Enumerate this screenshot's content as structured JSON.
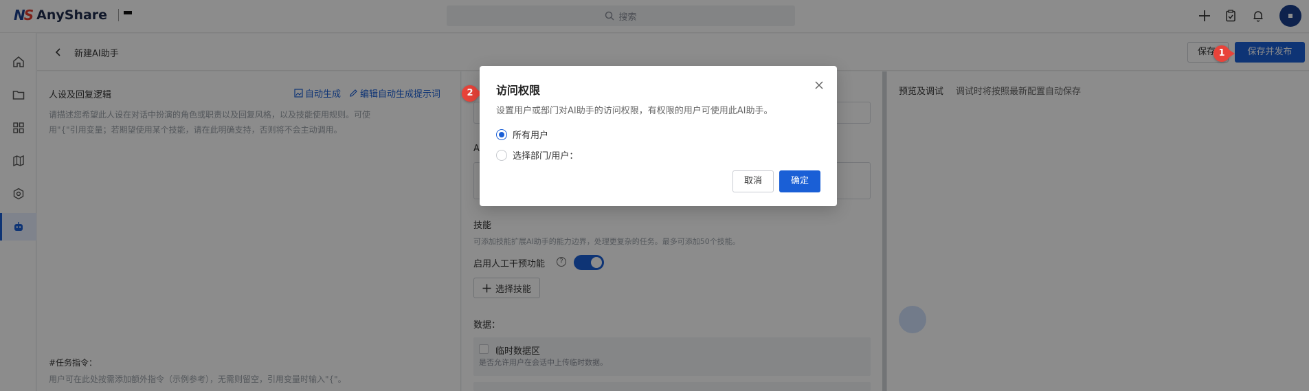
{
  "app": {
    "name": "AnyShare"
  },
  "search": {
    "placeholder": "搜索"
  },
  "header": {
    "title": "新建AI助手",
    "save_label": "保存",
    "publish_label": "保存并发布"
  },
  "left_panel": {
    "persona_title": "人设及回复逻辑",
    "auto_generate": "自动生成",
    "edit_prompt": "编辑自动生成提示词",
    "persona_placeholder_1": "请描述您希望此人设在对话中扮演的角色或职责以及回复风格，以及技能使用规则。可使",
    "persona_placeholder_2": "用\"{\"引用变量；若期望使用某个技能，请在此明确支持，否则将不会主动调用。",
    "task_title": "#任务指令：",
    "task_placeholder": "用户可在此处按需添加额外指令（示例参考），无需则留空，引用变量时输入\"{\"。"
  },
  "mid_panel": {
    "partial_label": "A",
    "skills_title": "技能",
    "skills_desc": "可添加技能扩展AI助手的能力边界，处理更复杂的任务。最多可添加50个技能。",
    "manual_label": "启用人工干预功能",
    "select_skill": "选择技能",
    "data_title": "数据：",
    "temp_data_title": "临时数据区",
    "temp_data_desc": "是否允许用户在会话中上传临时数据。"
  },
  "right_panel": {
    "preview_title": "预览及调试",
    "preview_desc": "调试时将按照最新配置自动保存"
  },
  "modal": {
    "title": "访问权限",
    "description": "设置用户或部门对AI助手的访问权限，有权限的用户可使用此AI助手。",
    "option_all": "所有用户",
    "option_select": "选择部门/用户：",
    "selected": "所有用户",
    "cancel": "取消",
    "confirm": "确定"
  },
  "steps": {
    "one": "1",
    "two": "2"
  },
  "colors": {
    "accent": "#1a5fd6",
    "step_marker": "#e8433a",
    "brand_dark": "#1a3e8c"
  },
  "icons": [
    "search-icon",
    "plus-icon",
    "task-icon",
    "bell-icon",
    "home-icon",
    "folder-icon",
    "apps-icon",
    "map-icon",
    "settings-hex-icon",
    "robot-icon",
    "back-icon",
    "image-icon",
    "edit-icon",
    "help-icon",
    "plus-icon",
    "close-icon"
  ]
}
